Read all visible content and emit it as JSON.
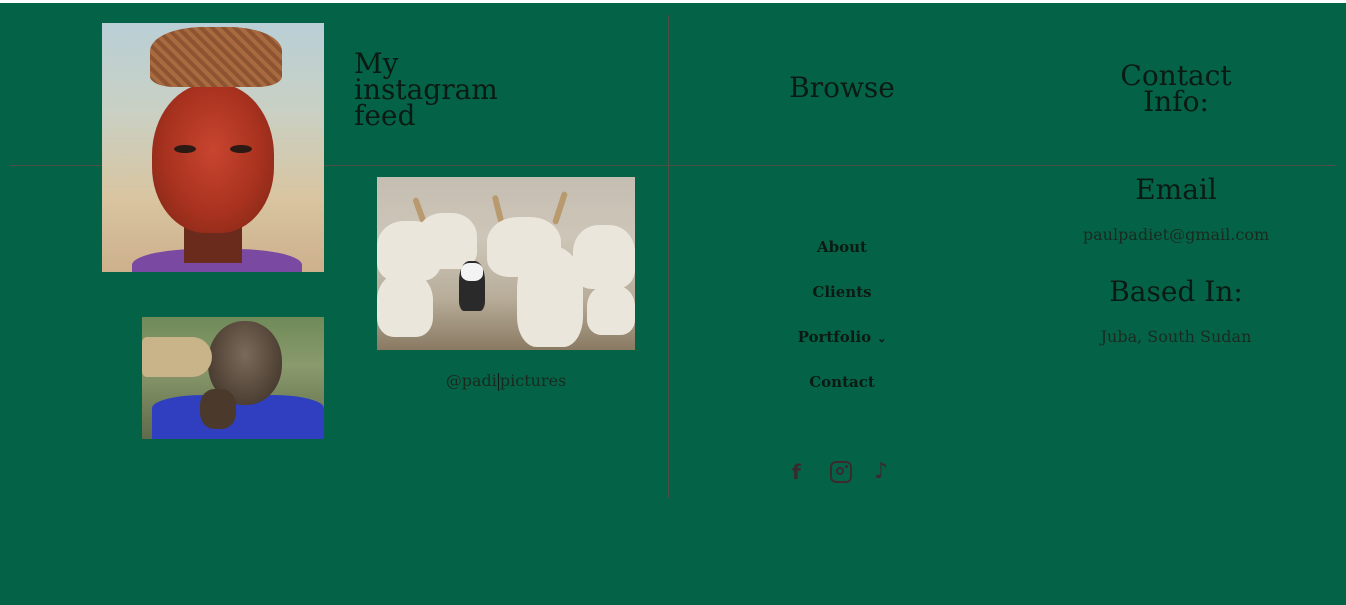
{
  "instagram": {
    "title": "My instagram feed",
    "handle_before": "@padi",
    "handle_after": "pictures"
  },
  "browse": {
    "title": "Browse",
    "links": [
      {
        "label": "About"
      },
      {
        "label": "Clients"
      },
      {
        "label": "Portfolio",
        "has_dropdown": true
      },
      {
        "label": "Contact"
      }
    ],
    "social": [
      {
        "icon": "facebook-icon",
        "glyph": "f"
      },
      {
        "icon": "instagram-icon"
      },
      {
        "icon": "tiktok-icon",
        "glyph": "♪"
      }
    ]
  },
  "contact": {
    "title": "Contact Info:",
    "email_title": "Email",
    "email": "paulpadiet@gmail.com",
    "based_title": "Based In:",
    "location": "Juba, South Sudan"
  },
  "colors": {
    "background": "#046347",
    "divider": "#4d4f45",
    "text": "#0b1a12"
  }
}
